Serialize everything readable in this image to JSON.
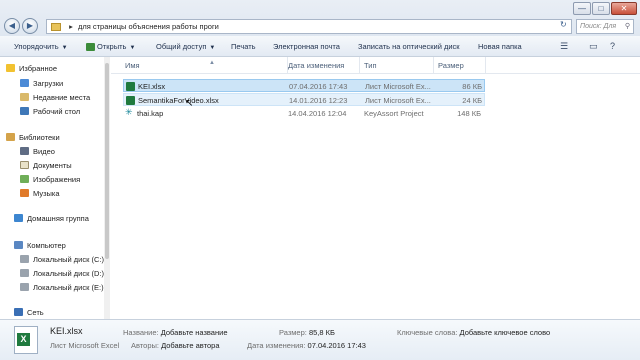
{
  "window": {
    "min_label": "—",
    "max_label": "□",
    "close_label": "✕"
  },
  "address": {
    "sep": "▸",
    "path": "для страницы объяснения работы проги",
    "refresh": "↻",
    "search_placeholder": "Поиск: Для ст..."
  },
  "toolbar": {
    "organize": "Упорядочить",
    "open": "Открыть",
    "share": "Общий доступ",
    "print": "Печать",
    "email": "Электронная почта",
    "burn": "Записать на оптический диск",
    "new_folder": "Новая папка"
  },
  "nav": {
    "favorites": "Избранное",
    "downloads": "Загрузки",
    "recent": "Недавние места",
    "desktop": "Рабочий стол",
    "libraries": "Библиотеки",
    "video": "Видео",
    "documents": "Документы",
    "images": "Изображения",
    "music": "Музыка",
    "homegroup": "Домашняя группа",
    "computer": "Компьютер",
    "disk_c": "Локальный диск (C:)",
    "disk_d": "Локальный диск (D:)",
    "disk_e": "Локальный диск (E:)",
    "network": "Сеть"
  },
  "columns": {
    "name": "Имя",
    "date": "Дата изменения",
    "type": "Тип",
    "size": "Размер"
  },
  "files": [
    {
      "name": "KEI.xlsx",
      "date": "07.04.2016 17:43",
      "type": "Лист Microsoft Ex...",
      "size": "86 КБ",
      "icon": "excel-icon",
      "state": "selected"
    },
    {
      "name": "SemantikaForVideo.xlsx",
      "date": "14.01.2016 12:23",
      "type": "Лист Microsoft Ex...",
      "size": "24 КБ",
      "icon": "excel-icon",
      "state": "hover"
    },
    {
      "name": "thai.kap",
      "date": "14.04.2016 12:04",
      "type": "KeyAssort Project",
      "size": "148 КБ",
      "icon": "keyassort-icon",
      "state": "normal"
    }
  ],
  "details": {
    "filename": "KEI.xlsx",
    "filetype": "Лист Microsoft Excel",
    "title_label": "Название:",
    "title_value": "Добавьте название",
    "authors_label": "Авторы:",
    "authors_value": "Добавьте автора",
    "size_label": "Размер:",
    "size_value": "85,8 КБ",
    "modified_label": "Дата изменения:",
    "modified_value": "07.04.2016 17:43",
    "keywords_label": "Ключевые слова:",
    "keywords_value": "Добавьте ключевое слово"
  }
}
